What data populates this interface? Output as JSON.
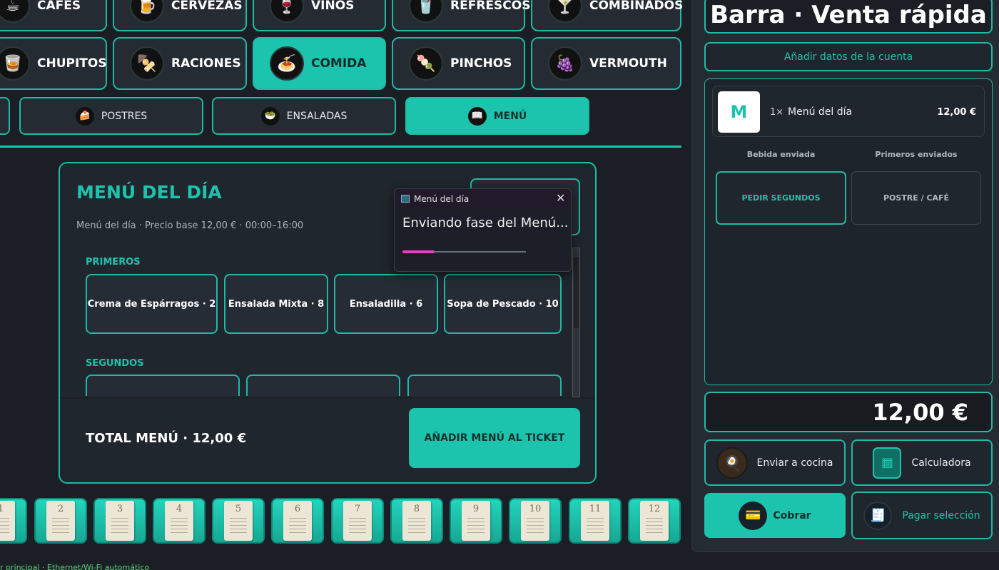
{
  "categories_row1": [
    "CAFÉS",
    "CERVEZAS",
    "VINOS",
    "REFRESCOS",
    "COMBINADOS"
  ],
  "categories_row2": [
    "CHUPITOS",
    "RACIONES",
    "COMIDA",
    "PINCHOS",
    "VERMOUTH"
  ],
  "active_category": "COMIDA",
  "subcategories": [
    "POSTRES",
    "ENSALADAS",
    "MENÚ"
  ],
  "active_subcategory": "MENÚ",
  "menu_panel": {
    "title": "MENÚ DEL DÍA",
    "subtitle": "Menú del día · Precio base 12,00 € · 00:00–16:00",
    "section1": "PRIMEROS",
    "primeros": [
      "Crema de Espárragos · 2",
      "Ensalada Mixta · 8",
      "Ensaladilla · 6",
      "Sopa de Pescado · 10"
    ],
    "section2": "SEGUNDOS",
    "total": "TOTAL MENÚ · 12,00 €",
    "add_button": "AÑADIR MENÚ AL TICKET"
  },
  "dialog": {
    "title": "Menú del día",
    "message": "Enviando fase del Menú...",
    "progress": 0.26
  },
  "tables": [
    "1",
    "2",
    "3",
    "4",
    "5",
    "6",
    "7",
    "8",
    "9",
    "10",
    "11",
    "12"
  ],
  "footer_status": "r principal · Ethernet/Wi-Fi automático",
  "right_panel": {
    "title": "Barra · Venta rápida",
    "account_button": "Añadir datos de la cuenta",
    "ticket_item": {
      "avatar": "M",
      "qty": "1×",
      "name": "Menú del día",
      "price": "12,00 €"
    },
    "status_left": "Bebida enviada",
    "status_right": "Primeros enviados",
    "btn_segundos": "PEDIR SEGUNDOS",
    "btn_postre": "POSTRE / CAFÉ",
    "total": "12,00 €",
    "send_kitchen": "Enviar a cocina",
    "calculator": "Calculadora",
    "charge": "Cobrar",
    "pay_selection": "Pagar selección"
  },
  "colors": {
    "accent": "#1dc4ad",
    "background": "#1b1f25",
    "panel": "#252b33",
    "progress": "#d946c8"
  }
}
